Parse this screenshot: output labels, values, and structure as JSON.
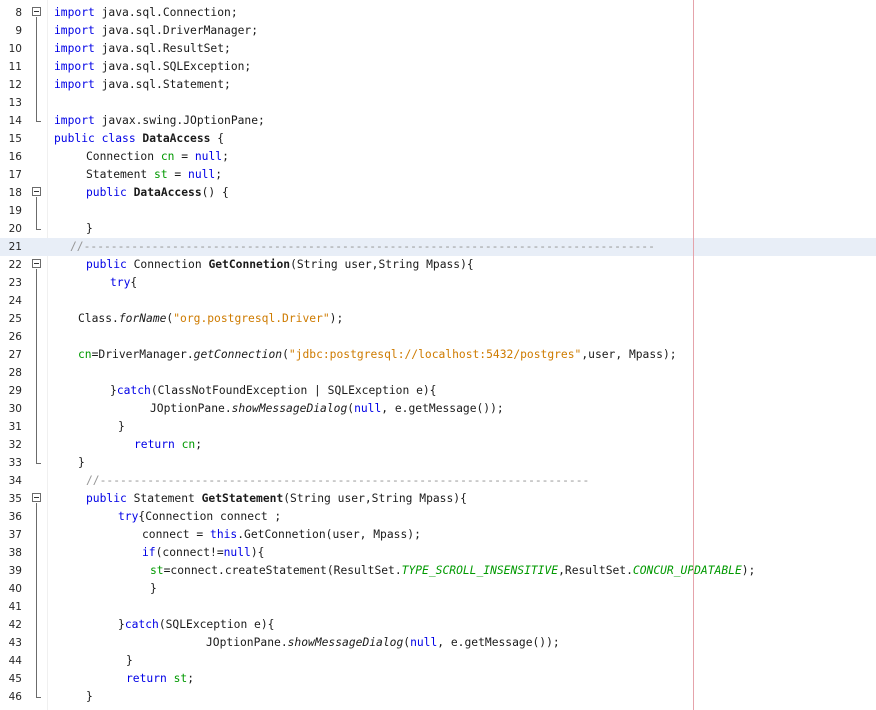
{
  "editor": {
    "lines": [
      {
        "n": "8",
        "indent": 0,
        "tokens": [
          [
            "kw",
            "import"
          ],
          [
            "",
            "java.sql.Connection;"
          ]
        ]
      },
      {
        "n": "9",
        "indent": 0,
        "tokens": [
          [
            "kw",
            "import"
          ],
          [
            "",
            "java.sql.DriverManager;"
          ]
        ]
      },
      {
        "n": "10",
        "indent": 0,
        "tokens": [
          [
            "kw",
            "import"
          ],
          [
            "",
            "java.sql.ResultSet;"
          ]
        ]
      },
      {
        "n": "11",
        "indent": 0,
        "tokens": [
          [
            "kw",
            "import"
          ],
          [
            "",
            "java.sql.SQLException;"
          ]
        ]
      },
      {
        "n": "12",
        "indent": 0,
        "tokens": [
          [
            "kw",
            "import"
          ],
          [
            "",
            "java.sql.Statement;"
          ]
        ]
      },
      {
        "n": "13",
        "indent": 0,
        "tokens": []
      },
      {
        "n": "14",
        "indent": 0,
        "tokens": [
          [
            "kw",
            "import"
          ],
          [
            "",
            "javax.swing.JOptionPane;"
          ]
        ]
      },
      {
        "n": "15",
        "indent": 0,
        "tokens": [
          [
            "kw",
            "public class "
          ],
          [
            "b",
            "DataAccess"
          ],
          [
            "",
            " {"
          ]
        ]
      },
      {
        "n": "16",
        "indent": 32,
        "tokens": [
          [
            "",
            "Connection "
          ],
          [
            "fld",
            "cn"
          ],
          [
            "",
            " = "
          ],
          [
            "kw",
            "null"
          ],
          [
            "",
            ";"
          ]
        ]
      },
      {
        "n": "17",
        "indent": 32,
        "tokens": [
          [
            "",
            "Statement "
          ],
          [
            "fld",
            "st"
          ],
          [
            "",
            " = "
          ],
          [
            "kw",
            "null"
          ],
          [
            "",
            ";"
          ]
        ]
      },
      {
        "n": "18",
        "indent": 32,
        "tokens": [
          [
            "kw",
            "public "
          ],
          [
            "b",
            "DataAccess"
          ],
          [
            "",
            "() {"
          ]
        ]
      },
      {
        "n": "19",
        "indent": 0,
        "tokens": []
      },
      {
        "n": "20",
        "indent": 32,
        "tokens": [
          [
            "",
            "}"
          ]
        ]
      },
      {
        "n": "21",
        "indent": 16,
        "tokens": [
          [
            "cm",
            "//------------------------------------------------------------------------------------"
          ]
        ]
      },
      {
        "n": "22",
        "indent": 32,
        "tokens": [
          [
            "kw",
            "public "
          ],
          [
            "",
            "Connection "
          ],
          [
            "b",
            "GetConnetion"
          ],
          [
            "",
            "(String user,String Mpass){"
          ]
        ]
      },
      {
        "n": "23",
        "indent": 56,
        "tokens": [
          [
            "kw",
            "try"
          ],
          [
            "",
            "{"
          ]
        ]
      },
      {
        "n": "24",
        "indent": 0,
        "tokens": []
      },
      {
        "n": "25",
        "indent": 24,
        "tokens": [
          [
            "",
            "Class."
          ],
          [
            "it",
            "forName"
          ],
          [
            "",
            "("
          ],
          [
            "str",
            "\"org.postgresql.Driver\""
          ],
          [
            "",
            ");"
          ]
        ]
      },
      {
        "n": "26",
        "indent": 0,
        "tokens": []
      },
      {
        "n": "27",
        "indent": 24,
        "tokens": [
          [
            "fld",
            "cn"
          ],
          [
            "",
            "=DriverManager."
          ],
          [
            "it",
            "getConnection"
          ],
          [
            "",
            "("
          ],
          [
            "str",
            "\"jdbc:postgresql://localhost:5432/postgres\""
          ],
          [
            "",
            ",user, Mpass);"
          ]
        ]
      },
      {
        "n": "28",
        "indent": 0,
        "tokens": []
      },
      {
        "n": "29",
        "indent": 56,
        "tokens": [
          [
            "",
            "}"
          ],
          [
            "kw",
            "catch"
          ],
          [
            "",
            "(ClassNotFoundException | SQLException e){"
          ]
        ]
      },
      {
        "n": "30",
        "indent": 96,
        "tokens": [
          [
            "",
            "JOptionPane."
          ],
          [
            "it",
            "showMessageDialog"
          ],
          [
            "",
            "("
          ],
          [
            "kw",
            "null"
          ],
          [
            "",
            ", e.getMessage());"
          ]
        ]
      },
      {
        "n": "31",
        "indent": 64,
        "tokens": [
          [
            "",
            "}"
          ]
        ]
      },
      {
        "n": "32",
        "indent": 80,
        "tokens": [
          [
            "kw",
            "return "
          ],
          [
            "fld",
            "cn"
          ],
          [
            "",
            ";"
          ]
        ]
      },
      {
        "n": "33",
        "indent": 24,
        "tokens": [
          [
            "",
            "}"
          ]
        ]
      },
      {
        "n": "34",
        "indent": 32,
        "tokens": [
          [
            "cm",
            "//------------------------------------------------------------------------"
          ]
        ]
      },
      {
        "n": "35",
        "indent": 32,
        "tokens": [
          [
            "kw",
            "public "
          ],
          [
            "",
            "Statement "
          ],
          [
            "b",
            "GetStatement"
          ],
          [
            "",
            "(String user,String Mpass){"
          ]
        ]
      },
      {
        "n": "36",
        "indent": 64,
        "tokens": [
          [
            "kw",
            "try"
          ],
          [
            "",
            "{Connection connect ;"
          ]
        ]
      },
      {
        "n": "37",
        "indent": 88,
        "tokens": [
          [
            "",
            "connect = "
          ],
          [
            "kw",
            "this"
          ],
          [
            "",
            ".GetConnetion(user, Mpass);"
          ]
        ]
      },
      {
        "n": "38",
        "indent": 88,
        "tokens": [
          [
            "kw",
            "if"
          ],
          [
            "",
            "(connect!="
          ],
          [
            "kw",
            "null"
          ],
          [
            "",
            "){"
          ]
        ]
      },
      {
        "n": "39",
        "indent": 96,
        "tokens": [
          [
            "fld",
            "st"
          ],
          [
            "",
            "=connect.createStatement(ResultSet."
          ],
          [
            "sfld",
            "TYPE_SCROLL_INSENSITIVE"
          ],
          [
            "",
            ",ResultSet."
          ],
          [
            "sfld",
            "CONCUR_UPDATABLE"
          ],
          [
            "",
            ");"
          ]
        ]
      },
      {
        "n": "40",
        "indent": 96,
        "tokens": [
          [
            "",
            "}"
          ]
        ]
      },
      {
        "n": "41",
        "indent": 0,
        "tokens": []
      },
      {
        "n": "42",
        "indent": 64,
        "tokens": [
          [
            "",
            "}"
          ],
          [
            "kw",
            "catch"
          ],
          [
            "",
            "(SQLException e){"
          ]
        ]
      },
      {
        "n": "43",
        "indent": 152,
        "tokens": [
          [
            "",
            "JOptionPane."
          ],
          [
            "it",
            "showMessageDialog"
          ],
          [
            "",
            "("
          ],
          [
            "kw",
            "null"
          ],
          [
            "",
            ", e.getMessage());"
          ]
        ]
      },
      {
        "n": "44",
        "indent": 72,
        "tokens": [
          [
            "",
            "}"
          ]
        ]
      },
      {
        "n": "45",
        "indent": 72,
        "tokens": [
          [
            "kw",
            "return "
          ],
          [
            "fld",
            "st"
          ],
          [
            "",
            ";"
          ]
        ]
      },
      {
        "n": "46",
        "indent": 32,
        "tokens": [
          [
            "",
            "}"
          ]
        ]
      }
    ],
    "highlight_line": "21",
    "fold_markers": [
      "8",
      "18",
      "22",
      "35"
    ],
    "colors": {
      "keyword": "#0000e6",
      "string": "#ce7b00",
      "comment": "#969696",
      "field": "#009900",
      "highlight": "#e8eef7",
      "margin_line": "#e5a3ab"
    }
  }
}
